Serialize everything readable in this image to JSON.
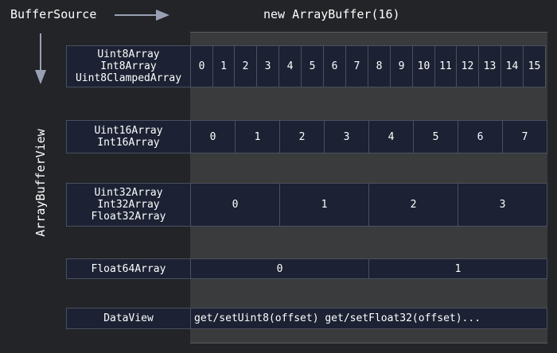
{
  "header": {
    "source_label": "BufferSource",
    "buffer_label": "new ArrayBuffer(16)",
    "view_axis_label": "ArrayBufferView"
  },
  "rows": [
    {
      "id": "uint8",
      "labels": [
        "Uint8Array",
        "Int8Array",
        "Uint8ClampedArray"
      ],
      "cells": [
        "0",
        "1",
        "2",
        "3",
        "4",
        "5",
        "6",
        "7",
        "8",
        "9",
        "10",
        "11",
        "12",
        "13",
        "14",
        "15"
      ]
    },
    {
      "id": "uint16",
      "labels": [
        "Uint16Array",
        "Int16Array"
      ],
      "cells": [
        "0",
        "1",
        "2",
        "3",
        "4",
        "5",
        "6",
        "7"
      ]
    },
    {
      "id": "uint32",
      "labels": [
        "Uint32Array",
        "Int32Array",
        "Float32Array"
      ],
      "cells": [
        "0",
        "1",
        "2",
        "3"
      ]
    },
    {
      "id": "float64",
      "labels": [
        "Float64Array"
      ],
      "cells": [
        "0",
        "1"
      ]
    }
  ],
  "dataview": {
    "label": "DataView",
    "methods": "get/setUint8(offset) get/setFloat32(offset)..."
  },
  "colors": {
    "background": "#222427",
    "box_fill": "#1c2233",
    "buffer_fill": "#3a3b3c",
    "arrow": "#9aa0b4"
  }
}
